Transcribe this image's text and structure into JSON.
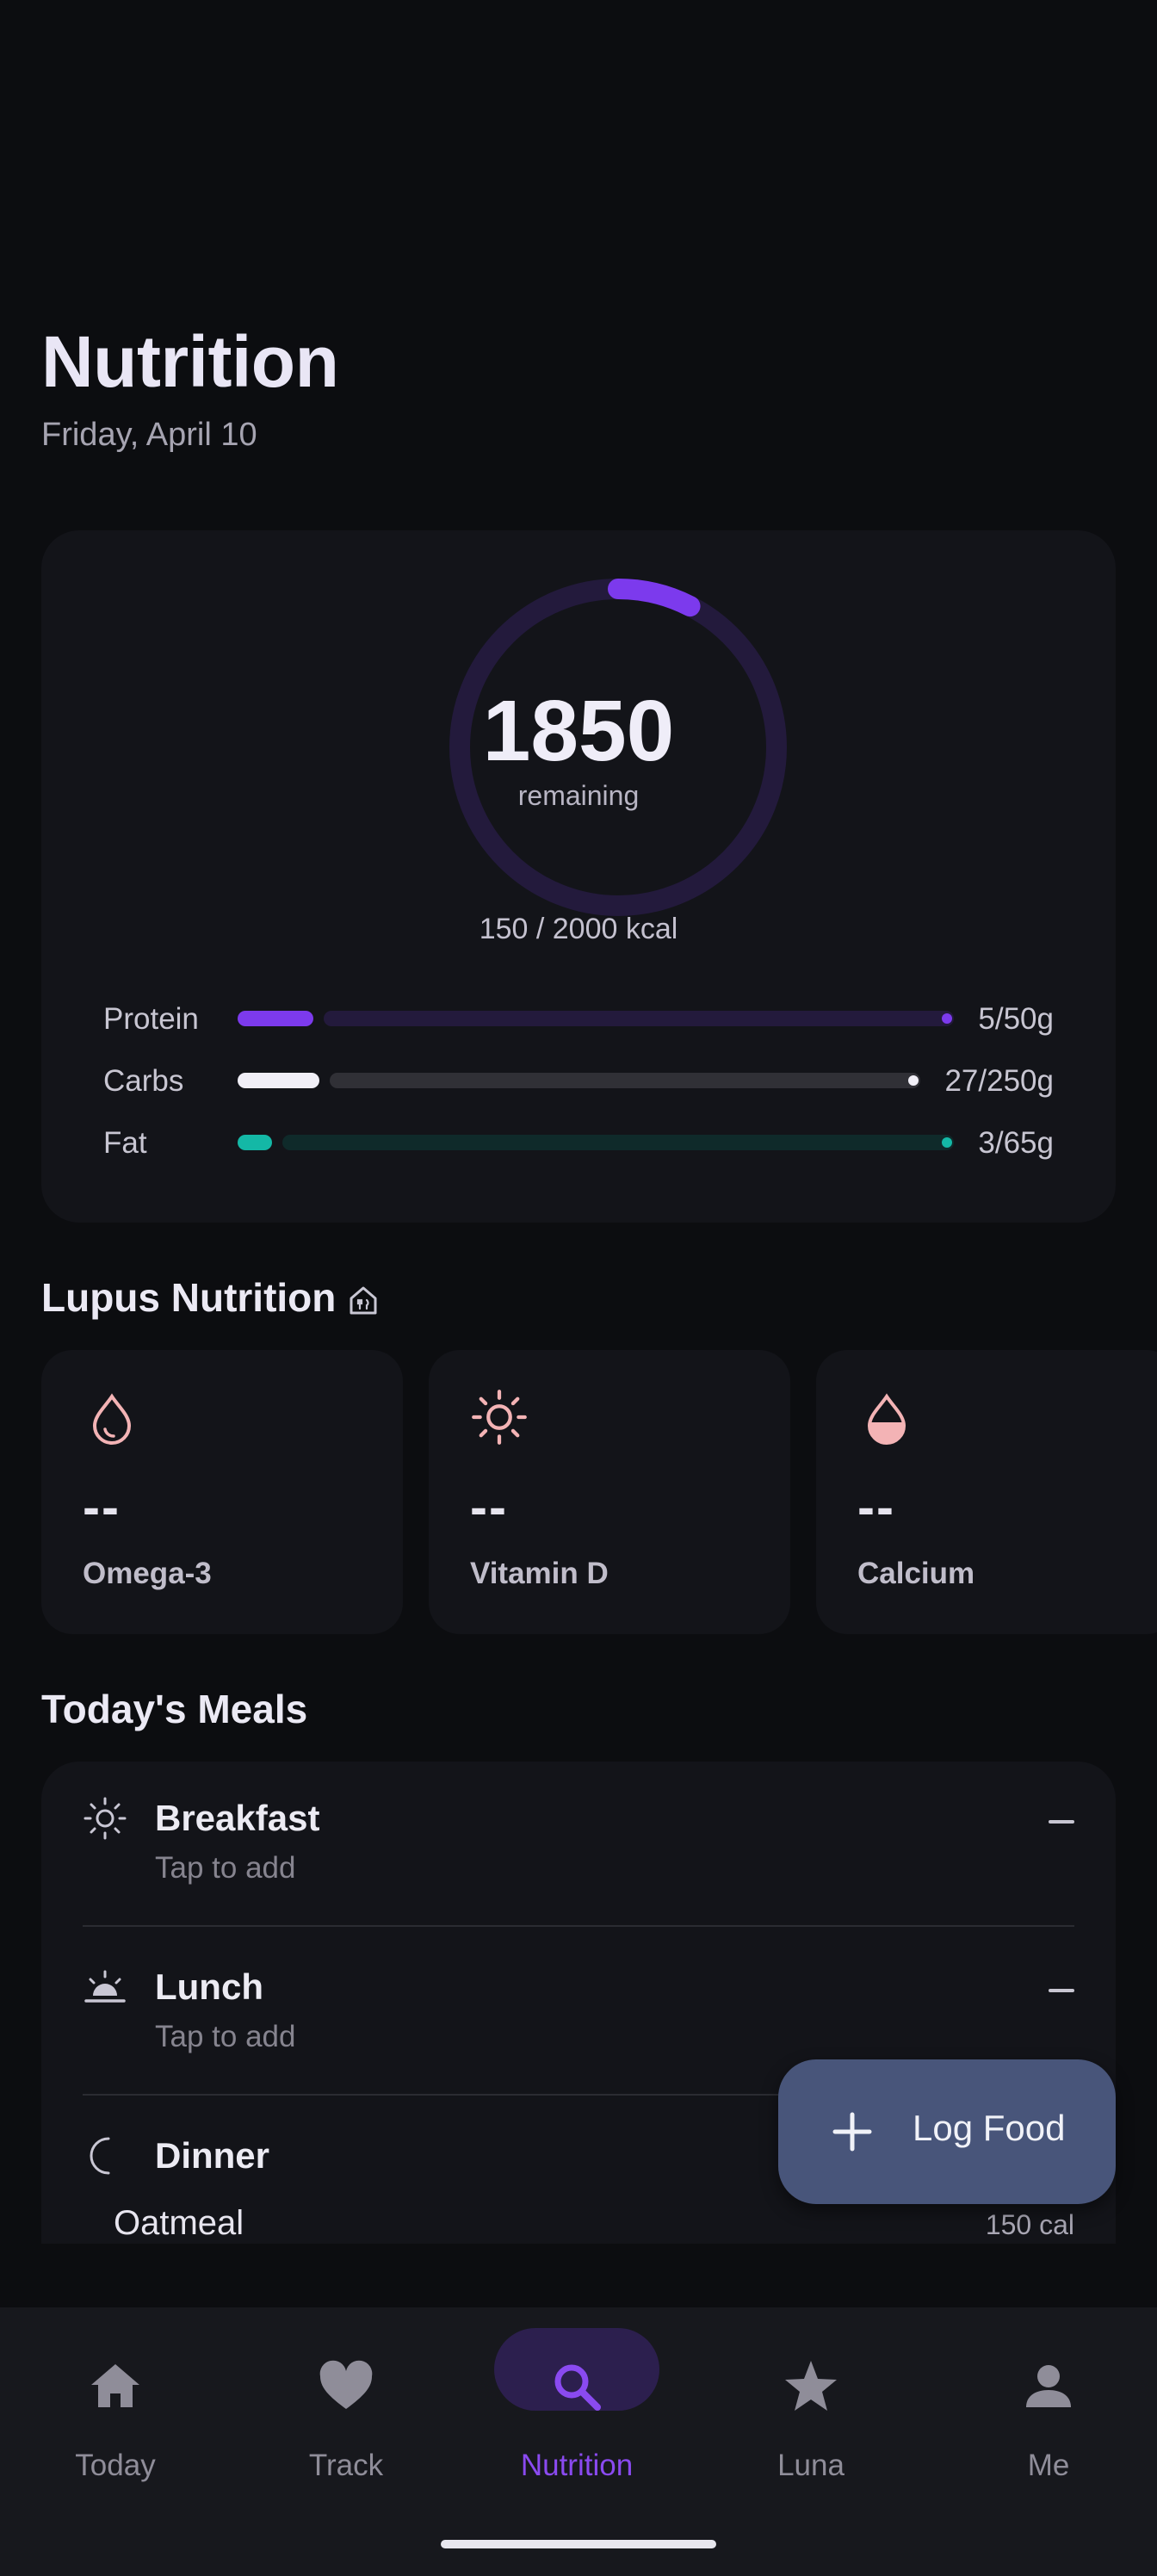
{
  "header": {
    "title": "Nutrition",
    "date": "Friday, April 10"
  },
  "calories": {
    "remaining_value": "1850",
    "remaining_label": "remaining",
    "summary": "150 / 2000 kcal",
    "consumed_fraction": 0.075
  },
  "macros": [
    {
      "label": "Protein",
      "value": "5/50g",
      "fraction": 0.1,
      "color": "#7c3aed",
      "track": "#231a3c"
    },
    {
      "label": "Carbs",
      "value": "27/250g",
      "fraction": 0.108,
      "color": "#f1eff7",
      "track": "#303036"
    },
    {
      "label": "Fat",
      "value": "3/65g",
      "fraction": 0.046,
      "color": "#14b8a6",
      "track": "#0f2a2a"
    }
  ],
  "lupus": {
    "title": "Lupus Nutrition",
    "cards": [
      {
        "value": "--",
        "name": "Omega-3",
        "icon": "droplet-icon"
      },
      {
        "value": "--",
        "name": "Vitamin D",
        "icon": "sun-icon"
      },
      {
        "value": "--",
        "name": "Calcium",
        "icon": "half-droplet-icon"
      }
    ]
  },
  "meals": {
    "title": "Today's Meals",
    "items": [
      {
        "name": "Breakfast",
        "sub": "Tap to add",
        "icon": "sun-icon"
      },
      {
        "name": "Lunch",
        "sub": "Tap to add",
        "icon": "sunrise-icon"
      },
      {
        "name": "Dinner",
        "icon": "moon-icon",
        "food": "Oatmeal",
        "food_cal": "150 cal"
      }
    ]
  },
  "fab": {
    "label": "Log Food"
  },
  "nav": {
    "items": [
      {
        "label": "Today",
        "icon": "home-icon"
      },
      {
        "label": "Track",
        "icon": "heart-icon"
      },
      {
        "label": "Nutrition",
        "icon": "search-icon",
        "active": true
      },
      {
        "label": "Luna",
        "icon": "star-icon"
      },
      {
        "label": "Me",
        "icon": "person-icon"
      }
    ]
  },
  "colors": {
    "accent": "#7c3aed",
    "background": "#0c0d10",
    "card": "#131419",
    "fab": "#48557a"
  }
}
